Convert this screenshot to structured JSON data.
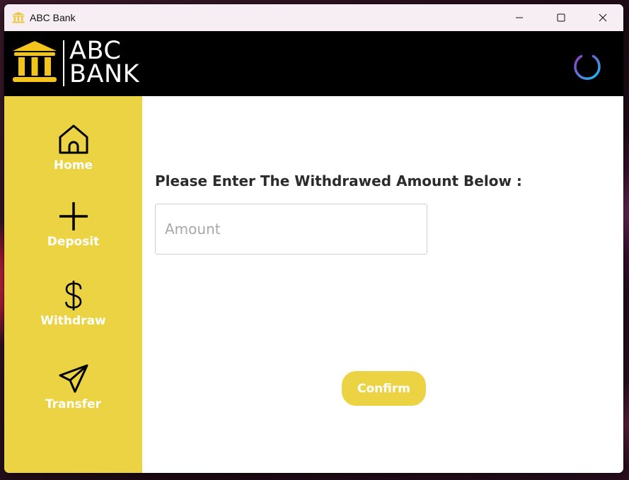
{
  "window": {
    "title": "ABC Bank"
  },
  "header": {
    "logo_line1": "ABC",
    "logo_line2": "BANK",
    "power_icon": "power-icon"
  },
  "sidebar": {
    "items": [
      {
        "label": "Home",
        "icon": "home-icon"
      },
      {
        "label": "Deposit",
        "icon": "plus-icon"
      },
      {
        "label": "Withdraw",
        "icon": "dollar-icon"
      },
      {
        "label": "Transfer",
        "icon": "paper-plane-icon"
      }
    ]
  },
  "main": {
    "prompt": "Please Enter The Withdrawed Amount Below :",
    "amount_placeholder": "Amount",
    "amount_value": "",
    "confirm_label": "Confirm"
  },
  "colors": {
    "accent": "#ECD343",
    "header_bg": "#000000",
    "power_gradient": [
      "#8e3fc2",
      "#1fb7f2"
    ]
  }
}
